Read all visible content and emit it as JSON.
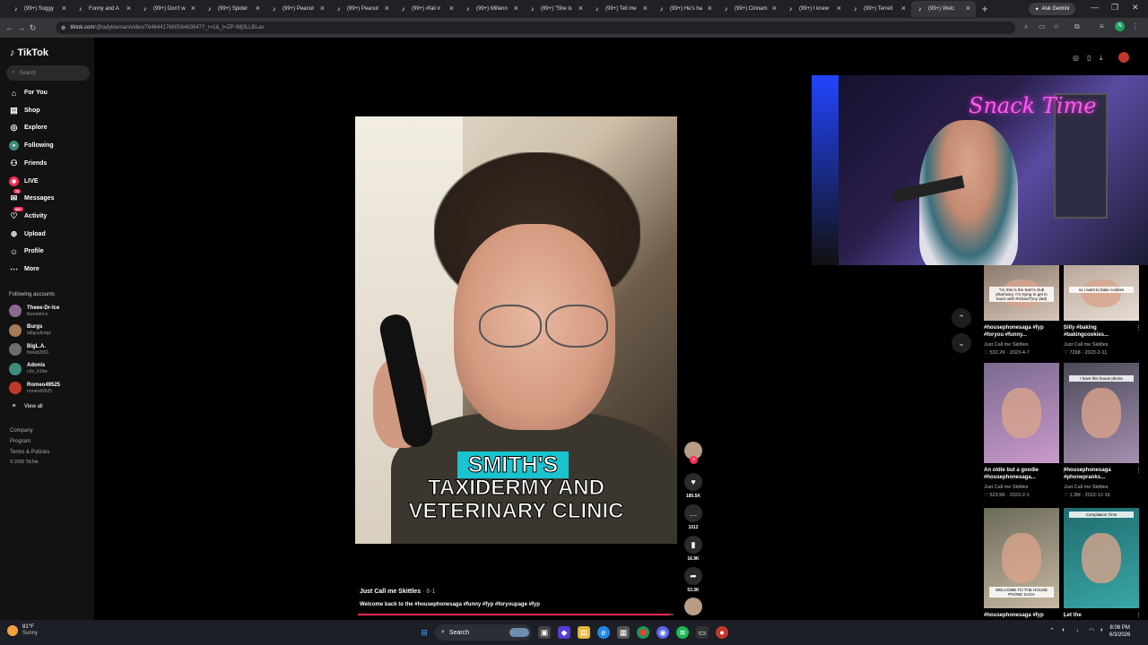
{
  "browser": {
    "tabs": [
      {
        "label": "(99+) Soggy",
        "active": false
      },
      {
        "label": "Funny and A",
        "active": false
      },
      {
        "label": "(99+) Don't w",
        "active": false
      },
      {
        "label": "(99+) Spider",
        "active": false
      },
      {
        "label": "(99+) Peanut",
        "active": false
      },
      {
        "label": "(99+) Peanut",
        "active": false
      },
      {
        "label": "(99+) #fail #",
        "active": false
      },
      {
        "label": "(99+) Millenn",
        "active": false
      },
      {
        "label": "(99+) \"She is",
        "active": false
      },
      {
        "label": "(99+) Tell me",
        "active": false
      },
      {
        "label": "(99+) He's ha",
        "active": false
      },
      {
        "label": "(99+) Cinnam",
        "active": false
      },
      {
        "label": "(99+) I knew",
        "active": false
      },
      {
        "label": "(99+) Terrell",
        "active": false
      },
      {
        "label": "(99+) Welc",
        "active": true
      }
    ],
    "new_tab": "+",
    "ask_gemini": "Ask Gemini",
    "url_host": "tiktok.com",
    "url_path": "/@ladykiernan/video/7646441766056463647?_r=1&_t=ZP-98j0LLBLax",
    "profile_initial": "N"
  },
  "sidebar": {
    "logo": "TikTok",
    "search_placeholder": "Search",
    "nav": [
      {
        "label": "For You",
        "icon": "home-icon",
        "color": "#ffffff"
      },
      {
        "label": "Shop",
        "icon": "shop-icon",
        "color": "#ffffff"
      },
      {
        "label": "Explore",
        "icon": "compass-icon",
        "color": "#ffffff"
      },
      {
        "label": "Following",
        "icon": "following-avatar-icon",
        "color": "#ffffff"
      },
      {
        "label": "Friends",
        "icon": "friends-icon",
        "color": "#ffffff"
      },
      {
        "label": "LIVE",
        "icon": "live-icon",
        "color": "#ffffff"
      },
      {
        "label": "Messages",
        "icon": "messages-icon",
        "color": "#ffffff",
        "badge": "72"
      },
      {
        "label": "Activity",
        "icon": "activity-icon",
        "color": "#ffffff",
        "badge": "99+"
      },
      {
        "label": "Upload",
        "icon": "upload-icon",
        "color": "#ffffff"
      },
      {
        "label": "Profile",
        "icon": "profile-icon",
        "color": "#ffffff"
      },
      {
        "label": "More",
        "icon": "more-icon",
        "color": "#ffffff"
      }
    ],
    "following_header": "Following accounts",
    "accounts": [
      {
        "name": "Theee-Dr-Ice",
        "handle": "theeedrice",
        "color": "#8a6b8f"
      },
      {
        "name": "Burgs",
        "handle": "tallguyburgz",
        "color": "#a57b5a"
      },
      {
        "name": "BigL.A.",
        "handle": "thekid2891",
        "color": "#6d6d6d"
      },
      {
        "name": "Adonis",
        "handle": "n3o_k1ttw",
        "color": "#3f8b7d"
      },
      {
        "name": "Romeo49525",
        "handle": "romeo49525",
        "color": "#c0392b"
      }
    ],
    "view_all": "View all",
    "footer": [
      "Company",
      "Program",
      "Terms & Policies",
      "© 2026 TikTok"
    ]
  },
  "video": {
    "caption_line1": "SMITH'S",
    "caption_line2": "TAXIDERMY AND",
    "caption_line3": "VETERINARY CLINIC",
    "author": "Just Call me Skittles",
    "date": "· 6-1",
    "description": "Welcome back to the #housephonesaga #funny #fyp #foryoupage #fyp",
    "progress": 0.99,
    "likes": "185.5K",
    "comments": "1012",
    "saves": "16.9K",
    "shares": "53.3K"
  },
  "overlay": {
    "neon_sign": "Snack Time"
  },
  "grid": [
    {
      "caption": "#housephonesaga #fyp #foryou #funny...",
      "author": "Just Call me Skittles",
      "stats": "♡ 532.2K · 2023-4-7",
      "overlay": "\"Hi, this is the Sam's club pharmacy. I'm trying to get in touch with Richard\"(my dad)",
      "colors": [
        "#8a7a6e",
        "#d8c7b8"
      ]
    },
    {
      "caption": "Silly #baking #bakingcookies...",
      "author": "Just Call me Skittles",
      "stats": "♡ 7268 · 2023-2-11",
      "overlay": "so I want to bake cookies",
      "colors": [
        "#b9a89a",
        "#e8ded4"
      ]
    },
    {
      "caption": "An oldie but a goodie #housephonesaga...",
      "author": "Just Call me Skittles",
      "stats": "♡ 523.9K · 2022-2-1",
      "overlay": "",
      "colors": [
        "#7a6a8f",
        "#c99ac9"
      ]
    },
    {
      "caption": "#housephonesaga #phonepranks...",
      "author": "Just Call me Skittles",
      "stats": "♡ 1.3M · 2022-12-16",
      "overlay": "I have this house phone",
      "colors": [
        "#4b4a58",
        "#a58fb0"
      ]
    },
    {
      "caption": "#housephonesaga #fyp",
      "author": "",
      "stats": "",
      "overlay": "WELCOME TO THE HOUSE PHONE SAGA",
      "colors": [
        "#6b6a5a",
        "#c7b8a3"
      ]
    },
    {
      "caption": "Let the",
      "author": "",
      "stats": "",
      "overlay": "Compilation Time",
      "colors": [
        "#1f6b6e",
        "#3aa7a5"
      ]
    }
  ],
  "taskbar": {
    "temp": "81°F",
    "condition": "Sunny",
    "search": "Search",
    "time": "8:06 PM",
    "date": "6/3/2026"
  }
}
